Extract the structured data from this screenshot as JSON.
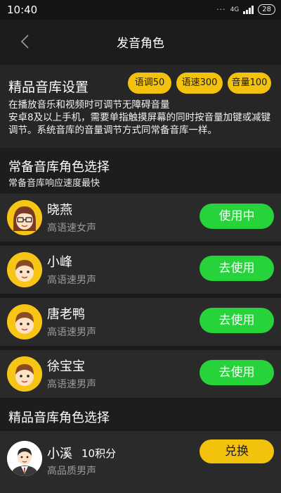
{
  "status_bar": {
    "time": "10:40",
    "network": "4G",
    "battery": "28"
  },
  "header": {
    "title": "发音角色"
  },
  "settings": {
    "title": "精品音库设置",
    "pills": [
      "语调50",
      "语速300",
      "音量100"
    ],
    "description": "在播放音乐和视频时可调节无障碍音量\n安卓8及以上手机，需要单指触摸屏幕的同时按音量加键或减键调节。系统音库的音量调节方式同常备音库一样。"
  },
  "standard_section": {
    "title": "常备音库角色选择",
    "subtitle": "常备音库响应速度最快"
  },
  "standard_roles": [
    {
      "name": "晓燕",
      "desc": "高语速女声",
      "button": "使用中",
      "avatar": "girl-avatar"
    },
    {
      "name": "小峰",
      "desc": "高语速男声",
      "button": "去使用",
      "avatar": "boy-avatar"
    },
    {
      "name": "唐老鸭",
      "desc": "高语速男声",
      "button": "去使用",
      "avatar": "boy-avatar"
    },
    {
      "name": "徐宝宝",
      "desc": "高语速男声",
      "button": "去使用",
      "avatar": "boy-avatar"
    }
  ],
  "premium_section": {
    "title": "精品音库角色选择"
  },
  "premium_roles": [
    {
      "name": "小溪",
      "points": "10积分",
      "desc": "高品质男声",
      "button": "兑换",
      "avatar": "man-in-suit-avatar"
    }
  ],
  "colors": {
    "accent_gold": "#f3c20d",
    "accent_green": "#26d33a",
    "background": "#1b1b1b"
  }
}
